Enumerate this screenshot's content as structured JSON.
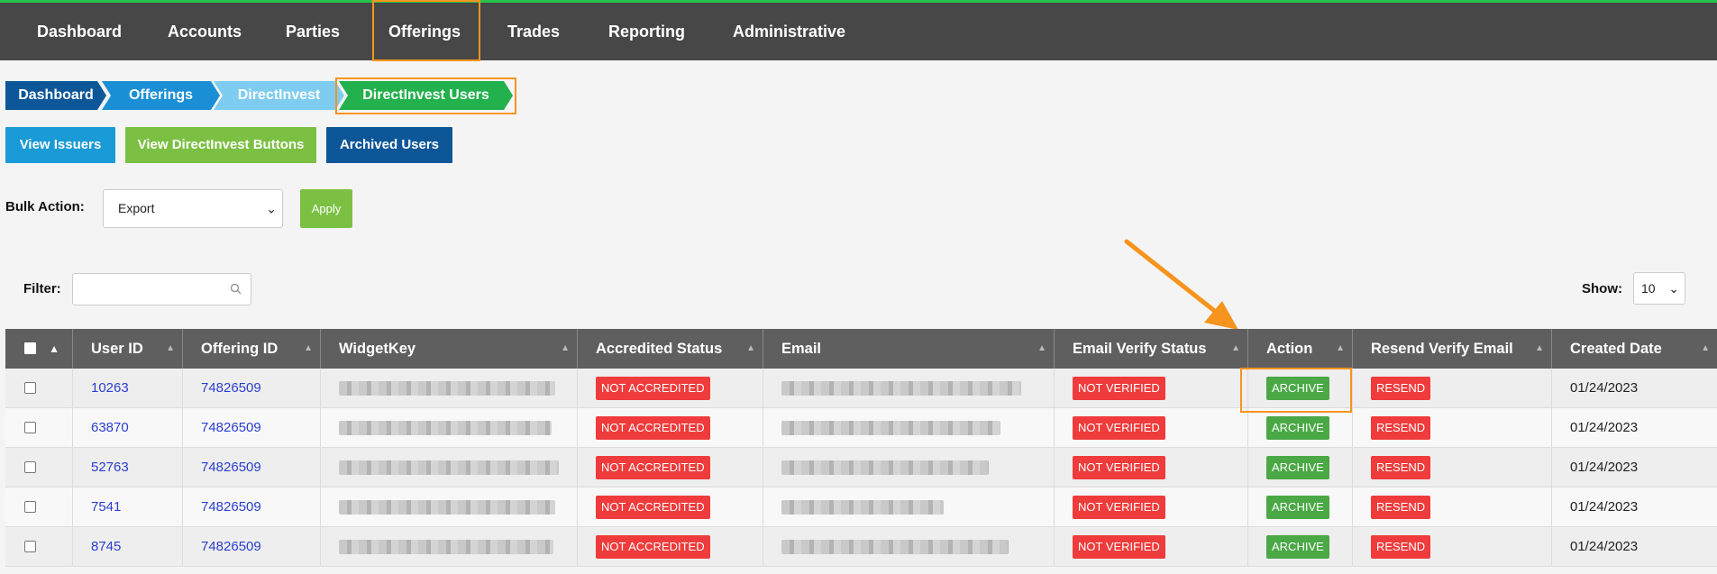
{
  "nav": {
    "items": [
      "Dashboard",
      "Accounts",
      "Parties",
      "Offerings",
      "Trades",
      "Reporting",
      "Administrative"
    ]
  },
  "breadcrumb": [
    "Dashboard",
    "Offerings",
    "DirectInvest",
    "DirectInvest Users"
  ],
  "buttons": {
    "view_issuers": "View Issuers",
    "view_directinvest_buttons": "View DirectInvest Buttons",
    "archived_users": "Archived Users"
  },
  "bulk_action": {
    "label": "Bulk Action:",
    "selected": "Export",
    "apply": "Apply"
  },
  "filter": {
    "label": "Filter:",
    "value": ""
  },
  "show": {
    "label": "Show:",
    "selected": "10"
  },
  "table": {
    "headers": [
      "User ID",
      "Offering ID",
      "WidgetKey",
      "Accredited Status",
      "Email",
      "Email Verify Status",
      "Action",
      "Resend Verify Email",
      "Created Date"
    ],
    "rows": [
      {
        "user_id": "10263",
        "offering_id": "74826509",
        "accredited": "NOT ACCREDITED",
        "verify": "NOT VERIFIED",
        "action": "ARCHIVE",
        "resend": "RESEND",
        "created": "01/24/2023"
      },
      {
        "user_id": "63870",
        "offering_id": "74826509",
        "accredited": "NOT ACCREDITED",
        "verify": "NOT VERIFIED",
        "action": "ARCHIVE",
        "resend": "RESEND",
        "created": "01/24/2023"
      },
      {
        "user_id": "52763",
        "offering_id": "74826509",
        "accredited": "NOT ACCREDITED",
        "verify": "NOT VERIFIED",
        "action": "ARCHIVE",
        "resend": "RESEND",
        "created": "01/24/2023"
      },
      {
        "user_id": "7541",
        "offering_id": "74826509",
        "accredited": "NOT ACCREDITED",
        "verify": "NOT VERIFIED",
        "action": "ARCHIVE",
        "resend": "RESEND",
        "created": "01/24/2023"
      },
      {
        "user_id": "8745",
        "offering_id": "74826509",
        "accredited": "NOT ACCREDITED",
        "verify": "NOT VERIFIED",
        "action": "ARCHIVE",
        "resend": "RESEND",
        "created": "01/24/2023"
      }
    ]
  },
  "colors": {
    "nav_bg": "#474747",
    "accent_green": "#27c24c",
    "highlight_orange": "#f7941d",
    "status_red": "#ef3b3b",
    "archive_green": "#4aa845"
  },
  "icons": [
    "search-icon",
    "chevron-down-icon",
    "sort-icon",
    "arrow-annotation"
  ]
}
